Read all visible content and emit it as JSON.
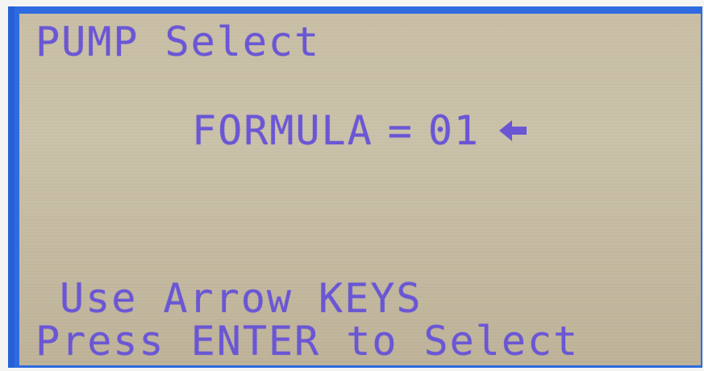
{
  "screen": {
    "title": "PUMP Select",
    "formula": {
      "label": "FORMULA",
      "operator": "=",
      "value": "01",
      "cursor_icon": "left-arrow-icon"
    },
    "instructions": {
      "line1": "Use Arrow KEYS",
      "line2": "Press ENTER to Select"
    }
  },
  "colors": {
    "lcd_background": "#c9bfa6",
    "lcd_text": "#6b57d6",
    "bezel": "#2f6be0"
  }
}
